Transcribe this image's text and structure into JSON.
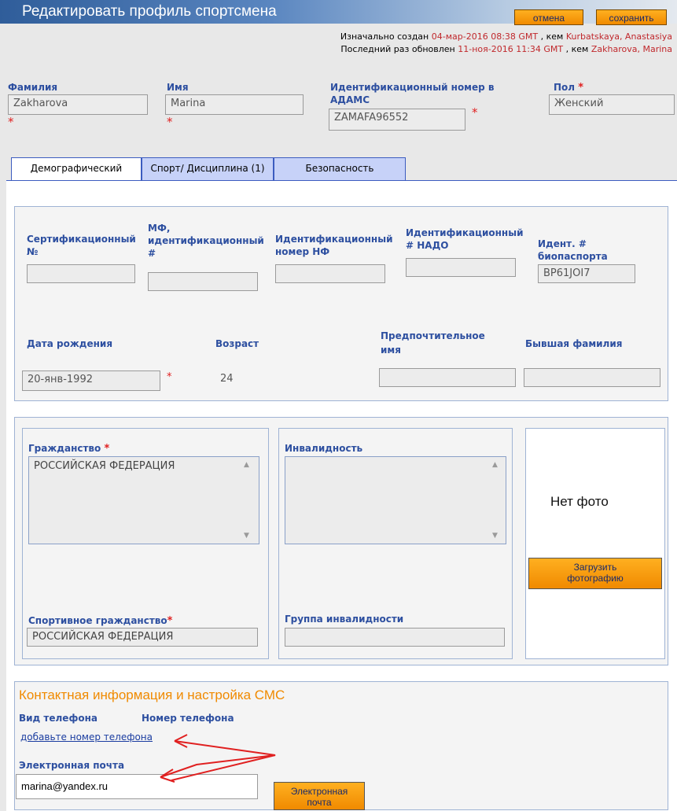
{
  "header": {
    "title": "Редактировать профиль спортсмена",
    "cancel_label": "отмена",
    "save_label": "сохранить",
    "created_prefix": "Изначально создан",
    "created_date": "04-мар-2016 08:38 GMT",
    "created_by_sep": ", кем",
    "created_by": "Kurbatskaya, Anastasiya",
    "updated_prefix": "Последний раз обновлен",
    "updated_date": "11-ноя-2016 11:34 GMT",
    "updated_by_sep": ", кем",
    "updated_by": "Zakharova, Marina"
  },
  "identity": {
    "last_name_label": "Фамилия",
    "last_name": "Zakharova",
    "first_name_label": "Имя",
    "first_name": "Marina",
    "adams_label_1": "Идентификационный номер в",
    "adams_label_2": "АДАМС",
    "adams_id": "ZAMAFA96552",
    "gender_label": "Пол",
    "gender": "Женский",
    "required_mark": "*"
  },
  "tabs": [
    {
      "label": "Демографический"
    },
    {
      "label": "Спорт/ Дисциплина (1)"
    },
    {
      "label": "Безопасность"
    }
  ],
  "demographic": {
    "cert_label_1": "Сертификационный",
    "cert_label_2": "№",
    "if_label_1": "МФ,",
    "if_label_2": "идентификационный",
    "if_label_3": "#",
    "nf_label_1": "Идентификационный",
    "nf_label_2": "номер НФ",
    "nado_label_1": "Идентификационный",
    "nado_label_2": "# НАДО",
    "bio_label_1": "Идент. #",
    "bio_label_2": "биопаспорта",
    "bio_value": "BP61JOI7",
    "dob_label": "Дата рождения",
    "dob_value": "20-янв-1992",
    "age_label": "Возраст",
    "age_value": "24",
    "pref_label_1": "Предпочтительное",
    "pref_label_2": "имя",
    "former_label": "Бывшая фамилия"
  },
  "citizenship": {
    "label": "Гражданство",
    "value": "РОССИЙСКАЯ ФЕДЕРАЦИЯ",
    "disability_label": "Инвалидность",
    "no_photo": "Нет фото",
    "upload_label_1": "Загрузить",
    "upload_label_2": "фотографию",
    "sport_label": "Спортивное гражданство",
    "sport_value": "РОССИЙСКАЯ ФЕДЕРАЦИЯ",
    "disability_group_label": "Группа инвалидности"
  },
  "contact": {
    "title": "Контактная информация и настройка СМС",
    "phone_type_label": "Вид телефона",
    "phone_number_label": "Номер телефона",
    "add_phone_link": "добавьте номер телефона",
    "email_label": "Электронная почта",
    "email_value": "marina@yandex.ru",
    "email_button_1": "Электронная",
    "email_button_2": "почта"
  },
  "colors": {
    "accent": "#f08a00",
    "label_blue": "#2d4fa0",
    "required_red": "#e02020",
    "annotation_red": "#e02020"
  }
}
